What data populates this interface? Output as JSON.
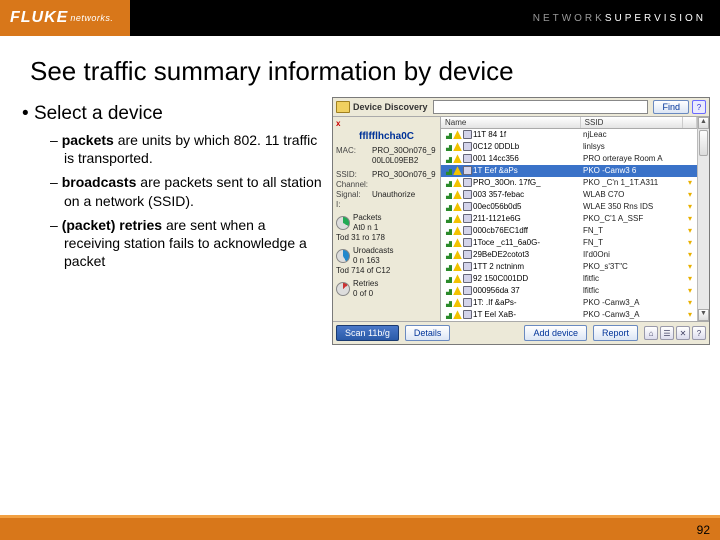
{
  "brand": {
    "logo": "FLUKE",
    "sub": "networks.",
    "tagline_a": "NETWORK",
    "tagline_b": "SUPERVISION"
  },
  "title": "See traffic summary information by device",
  "bullet": "Select a device",
  "subs": [
    {
      "b": "packets",
      "t": " are units by which 802. 11 traffic is transported."
    },
    {
      "b": "broadcasts",
      "t": " are packets sent to all station on a network (SSID)."
    },
    {
      "b": "(packet) retries",
      "t": " are sent when a receiving station fails to acknowledge a packet"
    }
  ],
  "panel": {
    "title_label": "Device Discovery",
    "find": "Find",
    "help": "?",
    "close": "x",
    "info": {
      "line1": "fflfflhcha0C",
      "mac_k": "MAC:",
      "mac_v1": "PRO_30On076_9",
      "mac_v2": "00L0L09EB2",
      "ssid_k": "SSID:",
      "ssid_v": "PRO_30On076_9",
      "chan_k": "Channel:",
      "sig_k": "Signal:",
      "sig_v": "Unauthorize",
      "chart1_t": "Packets",
      "chart1_a": "At0 n 1",
      "chart1_b": "Tod 31 ro 178",
      "chart2_t": "Uroadcasts",
      "chart2_a": "0 n 163",
      "chart2_b": "Tod 714 of C12",
      "chart3_t": "Retries",
      "chart3_a": "0 of 0"
    },
    "headers": {
      "name": "Name",
      "ssid": "SSID"
    },
    "rows": [
      {
        "name": "11T 84 1f",
        "ssid": "njLeac"
      },
      {
        "name": "0C12 0DDLb",
        "ssid": "linlsys"
      },
      {
        "name": "001 14cc356",
        "ssid": "PRO orteraye Room A"
      },
      {
        "name": "1T Eef &aPs",
        "ssid": "PKO -Canw3 6",
        "sel": true
      },
      {
        "name": "PRO_30On. 17fG_",
        "ssid": "PKO _C'n 1_1T.A311",
        "arrow": true
      },
      {
        "name": "003 357-febac",
        "ssid": "WLAB C7O",
        "arrow": true
      },
      {
        "name": "00ec056b0d5",
        "ssid": "WLAE 350 Rns IDS",
        "arrow": true
      },
      {
        "name": "211-1121e6G",
        "ssid": "PKO_C'1 A_SSF",
        "arrow": true
      },
      {
        "name": "000cb76EC1dff",
        "ssid": "FN_T",
        "arrow": true
      },
      {
        "name": "1Toce _c11_6a0G-",
        "ssid": "FN_T",
        "arrow": true
      },
      {
        "name": "29BeDE2cotot3",
        "ssid": "Il'd0Oni",
        "arrow": true
      },
      {
        "name": "1TT 2 nctninm",
        "ssid": "PKO_s'3T\"C",
        "arrow": true
      },
      {
        "name": "92 150C001DD",
        "ssid": "lfitfic",
        "arrow": true
      },
      {
        "name": "000956da 37",
        "ssid": "lfitfic",
        "arrow": true
      },
      {
        "name": "1T: .If &aPs-",
        "ssid": "PKO -Canw3_A",
        "arrow": true
      },
      {
        "name": "1T Eel XaB-",
        "ssid": "PKO -Canw3_A",
        "arrow": true
      }
    ],
    "scan": "Scan 11b/g",
    "details": "Details",
    "add": "Add device",
    "report": "Report"
  },
  "page": "92"
}
